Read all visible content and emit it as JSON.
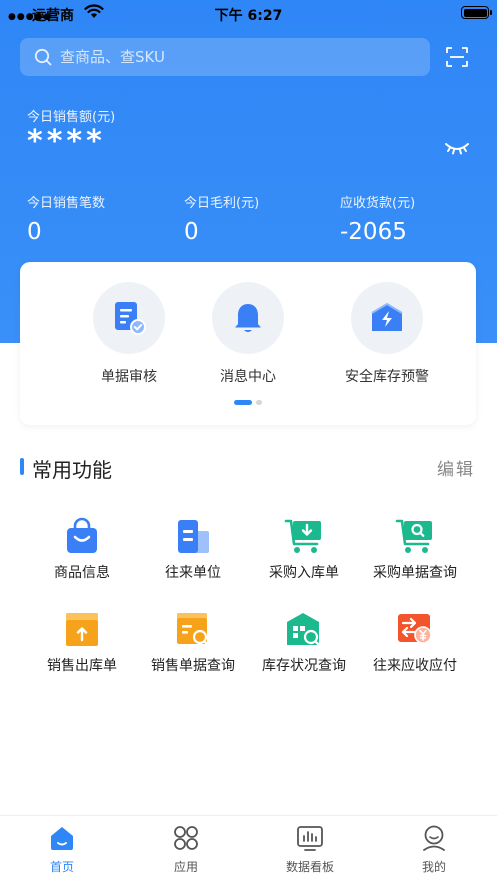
{
  "status_bar": {
    "carrier": "运营商",
    "time": "下午 6:27"
  },
  "search": {
    "placeholder": "查商品、查SKU"
  },
  "summary": {
    "sales_label": "今日销售额(元)",
    "sales_value": "****",
    "stats": [
      {
        "label": "今日销售笔数",
        "value": "0"
      },
      {
        "label": "今日毛利(元)",
        "value": "0"
      },
      {
        "label": "应收货款(元)",
        "value": "-2065"
      }
    ]
  },
  "quick_actions": [
    {
      "label": "单据审核",
      "icon": "document-check-icon"
    },
    {
      "label": "消息中心",
      "icon": "bell-icon"
    },
    {
      "label": "安全库存预警",
      "icon": "warehouse-alert-icon"
    }
  ],
  "common": {
    "title": "常用功能",
    "edit_label": "编辑",
    "items": [
      {
        "label": "商品信息",
        "icon": "shopping-bag-icon",
        "color": "#3a7ff6"
      },
      {
        "label": "往来单位",
        "icon": "building-icon",
        "color": "#3a7ff6"
      },
      {
        "label": "采购入库单",
        "icon": "cart-in-icon",
        "color": "#1db98e"
      },
      {
        "label": "采购单据查询",
        "icon": "cart-search-icon",
        "color": "#1db98e"
      },
      {
        "label": "销售出库单",
        "icon": "box-out-icon",
        "color": "#f7a21b"
      },
      {
        "label": "销售单据查询",
        "icon": "receipt-search-icon",
        "color": "#f7a21b"
      },
      {
        "label": "库存状况查询",
        "icon": "warehouse-search-icon",
        "color": "#1db98e"
      },
      {
        "label": "往来应收应付",
        "icon": "exchange-yen-icon",
        "color": "#f2552c"
      }
    ]
  },
  "tabs": [
    {
      "label": "首页",
      "icon": "home-icon",
      "active": true
    },
    {
      "label": "应用",
      "icon": "apps-icon",
      "active": false
    },
    {
      "label": "数据看板",
      "icon": "dashboard-icon",
      "active": false
    },
    {
      "label": "我的",
      "icon": "profile-icon",
      "active": false
    }
  ],
  "colors": {
    "primary": "#2f86f6",
    "green": "#1db98e",
    "orange": "#f7a21b",
    "red": "#f2552c"
  }
}
